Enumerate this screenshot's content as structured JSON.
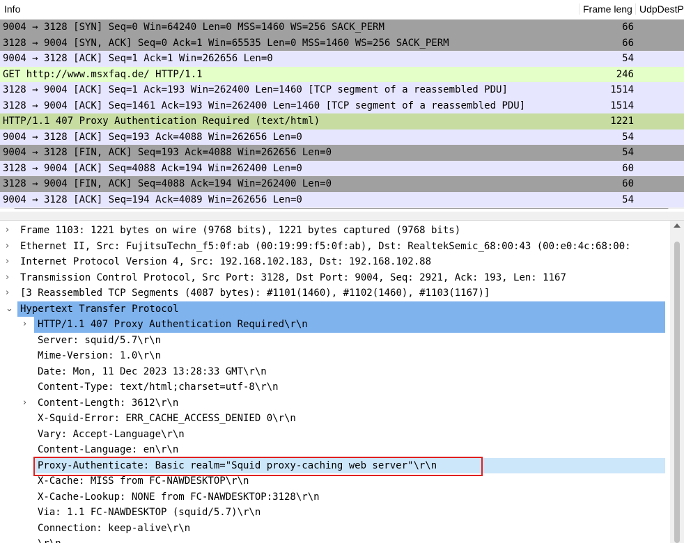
{
  "packet_list": {
    "columns": {
      "info": "Info",
      "frame_length": "Frame leng",
      "udp_dest": "UdpDestP"
    },
    "rows": [
      {
        "info": "9004 → 3128 [SYN] Seq=0 Win=64240 Len=0 MSS=1460 WS=256 SACK_PERM",
        "length": "66",
        "bg": "#a0a0a0",
        "fg": "#000000"
      },
      {
        "info": "3128 → 9004 [SYN, ACK] Seq=0 Ack=1 Win=65535 Len=0 MSS=1460 WS=256 SACK_PERM",
        "length": "66",
        "bg": "#a0a0a0",
        "fg": "#000000"
      },
      {
        "info": "9004 → 3128 [ACK] Seq=1 Ack=1 Win=262656 Len=0",
        "length": "54",
        "bg": "#e7e6ff",
        "fg": "#000000"
      },
      {
        "info": "GET http://www.msxfaq.de/ HTTP/1.1",
        "length": "246",
        "bg": "#e4ffc7",
        "fg": "#000000"
      },
      {
        "info": "3128 → 9004 [ACK] Seq=1 Ack=193 Win=262400 Len=1460 [TCP segment of a reassembled PDU]",
        "length": "1514",
        "bg": "#e7e6ff",
        "fg": "#000000"
      },
      {
        "info": "3128 → 9004 [ACK] Seq=1461 Ack=193 Win=262400 Len=1460 [TCP segment of a reassembled PDU]",
        "length": "1514",
        "bg": "#e7e6ff",
        "fg": "#000000"
      },
      {
        "info": "HTTP/1.1 407 Proxy Authentication Required  (text/html)",
        "length": "1221",
        "bg": "#c6dca0",
        "fg": "#000000"
      },
      {
        "info": "9004 → 3128 [ACK] Seq=193 Ack=4088 Win=262656 Len=0",
        "length": "54",
        "bg": "#e7e6ff",
        "fg": "#000000"
      },
      {
        "info": "9004 → 3128 [FIN, ACK] Seq=193 Ack=4088 Win=262656 Len=0",
        "length": "54",
        "bg": "#a0a0a0",
        "fg": "#000000"
      },
      {
        "info": "3128 → 9004 [ACK] Seq=4088 Ack=194 Win=262400 Len=0",
        "length": "60",
        "bg": "#e7e6ff",
        "fg": "#000000"
      },
      {
        "info": "3128 → 9004 [FIN, ACK] Seq=4088 Ack=194 Win=262400 Len=0",
        "length": "60",
        "bg": "#a0a0a0",
        "fg": "#000000"
      },
      {
        "info": "9004 → 3128 [ACK] Seq=194 Ack=4089 Win=262656 Len=0",
        "length": "54",
        "bg": "#e7e6ff",
        "fg": "#000000"
      }
    ]
  },
  "detail_tree": {
    "rows": [
      {
        "text": "Frame 1103: 1221 bytes on wire (9768 bits), 1221 bytes captured (9768 bits)",
        "arrow": "›",
        "level": 0,
        "state": ""
      },
      {
        "text": "Ethernet II, Src: FujitsuTechn_f5:0f:ab (00:19:99:f5:0f:ab), Dst: RealtekSemic_68:00:43 (00:e0:4c:68:00:",
        "arrow": "›",
        "level": 0,
        "state": ""
      },
      {
        "text": "Internet Protocol Version 4, Src: 192.168.102.183, Dst: 192.168.102.88",
        "arrow": "›",
        "level": 0,
        "state": ""
      },
      {
        "text": "Transmission Control Protocol, Src Port: 3128, Dst Port: 9004, Seq: 2921, Ack: 193, Len: 1167",
        "arrow": "›",
        "level": 0,
        "state": ""
      },
      {
        "text": "[3 Reassembled TCP Segments (4087 bytes): #1101(1460), #1102(1460), #1103(1167)]",
        "arrow": "›",
        "level": 0,
        "state": ""
      },
      {
        "text": "Hypertext Transfer Protocol",
        "arrow": "⌄",
        "level": 0,
        "state": "selected"
      },
      {
        "text": "HTTP/1.1 407 Proxy Authentication Required\\r\\n",
        "arrow": "›",
        "level": 1,
        "state": "selected"
      },
      {
        "text": "Server: squid/5.7\\r\\n",
        "arrow": "",
        "level": 1,
        "state": ""
      },
      {
        "text": "Mime-Version: 1.0\\r\\n",
        "arrow": "",
        "level": 1,
        "state": ""
      },
      {
        "text": "Date: Mon, 11 Dec 2023 13:28:33 GMT\\r\\n",
        "arrow": "",
        "level": 1,
        "state": ""
      },
      {
        "text": "Content-Type: text/html;charset=utf-8\\r\\n",
        "arrow": "",
        "level": 1,
        "state": ""
      },
      {
        "text": "Content-Length: 3612\\r\\n",
        "arrow": "›",
        "level": 1,
        "state": ""
      },
      {
        "text": "X-Squid-Error: ERR_CACHE_ACCESS_DENIED 0\\r\\n",
        "arrow": "",
        "level": 1,
        "state": ""
      },
      {
        "text": "Vary: Accept-Language\\r\\n",
        "arrow": "",
        "level": 1,
        "state": ""
      },
      {
        "text": "Content-Language: en\\r\\n",
        "arrow": "",
        "level": 1,
        "state": ""
      },
      {
        "text": "Proxy-Authenticate: Basic realm=\"Squid proxy-caching web server\"\\r\\n",
        "arrow": "",
        "level": 1,
        "state": "sublight"
      },
      {
        "text": "X-Cache: MISS from FC-NAWDESKTOP\\r\\n",
        "arrow": "",
        "level": 1,
        "state": ""
      },
      {
        "text": "X-Cache-Lookup: NONE from FC-NAWDESKTOP:3128\\r\\n",
        "arrow": "",
        "level": 1,
        "state": ""
      },
      {
        "text": "Via: 1.1 FC-NAWDESKTOP (squid/5.7)\\r\\n",
        "arrow": "",
        "level": 1,
        "state": ""
      },
      {
        "text": "Connection: keep-alive\\r\\n",
        "arrow": "",
        "level": 1,
        "state": ""
      },
      {
        "text": "\\r\\n",
        "arrow": "",
        "level": 1,
        "state": ""
      }
    ]
  }
}
